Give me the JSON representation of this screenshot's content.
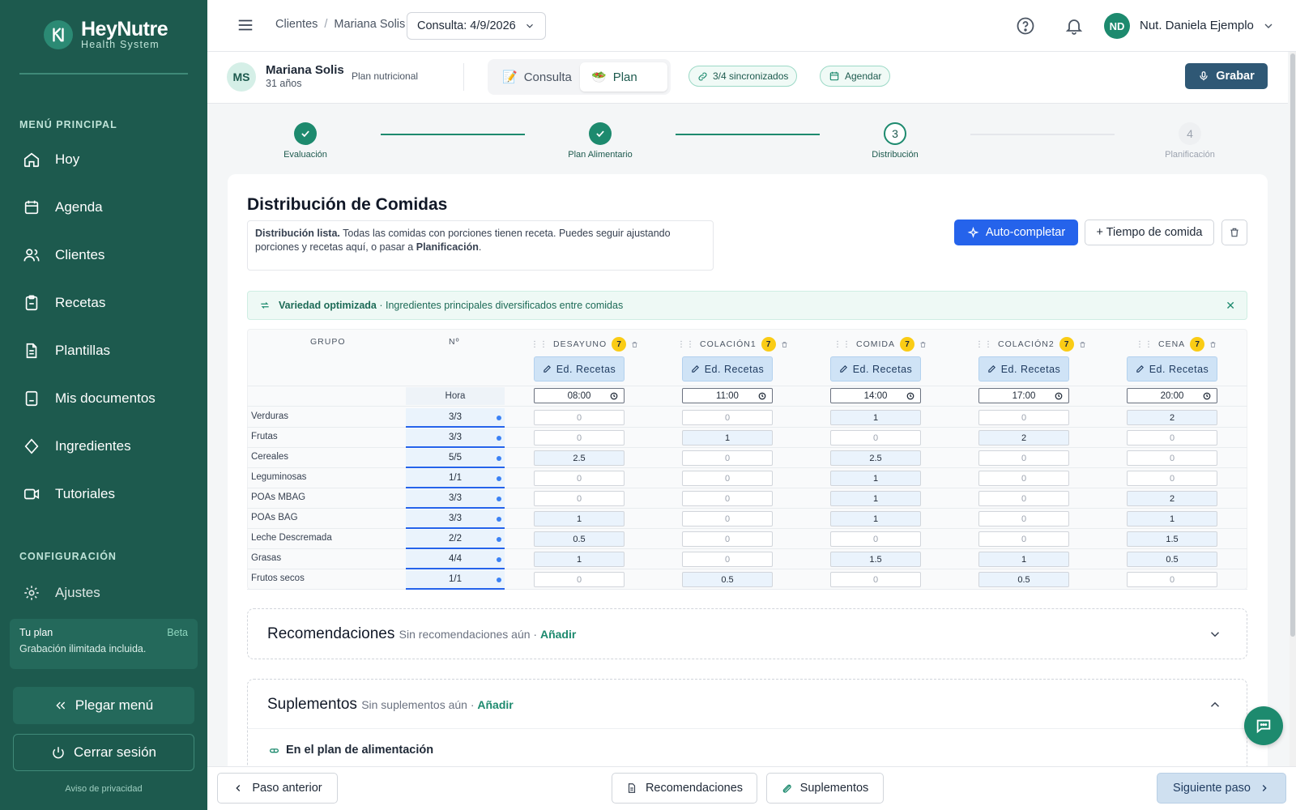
{
  "brand": {
    "name": "HeyNutre",
    "subtitle": "Health System"
  },
  "sidebar": {
    "section_main": "MENÚ PRINCIPAL",
    "items": [
      {
        "label": "Hoy",
        "icon": "home-icon"
      },
      {
        "label": "Agenda",
        "icon": "calendar-icon"
      },
      {
        "label": "Clientes",
        "icon": "users-icon"
      },
      {
        "label": "Recetas",
        "icon": "clipboard-icon"
      },
      {
        "label": "Plantillas",
        "icon": "file-text-icon"
      },
      {
        "label": "Mis documentos",
        "icon": "document-icon"
      },
      {
        "label": "Ingredientes",
        "icon": "tag-icon"
      },
      {
        "label": "Tutoriales",
        "icon": "video-icon"
      }
    ],
    "section_config": "CONFIGURACIÓN",
    "settings_label": "Ajustes",
    "plan": {
      "title": "Tu plan",
      "badge": "Beta",
      "description": "Grabación ilimitada incluida."
    },
    "collapse_label": "Plegar menú",
    "logout_label": "Cerrar sesión",
    "privacy_label": "Aviso de privacidad"
  },
  "topbar": {
    "breadcrumb": [
      "Clientes",
      "Mariana Solis"
    ],
    "breadcrumb_sep": "/",
    "consult_select": "Consulta: 4/9/2026",
    "user_initials": "ND",
    "user_name": "Nut. Daniela Ejemplo"
  },
  "patient": {
    "initials": "MS",
    "name": "Mariana Solis",
    "age": "31 años",
    "plan_label": "Plan nutricional",
    "tabs": [
      {
        "label": "Consulta",
        "active": false
      },
      {
        "label": "Plan",
        "active": true
      }
    ],
    "sync_label": "3/4 sincronizados",
    "schedule_label": "Agendar",
    "record_label": "Grabar"
  },
  "stepper": [
    {
      "number": "1",
      "label": "Evaluación",
      "state": "done"
    },
    {
      "number": "2",
      "label": "Plan Alimentario",
      "state": "done"
    },
    {
      "number": "3",
      "label": "Distribución",
      "state": "current"
    },
    {
      "number": "4",
      "label": "Planificación",
      "state": "todo"
    }
  ],
  "distribution": {
    "title": "Distribución de Comidas",
    "notice_bold": "Distribución lista.",
    "notice_text": " Todas las comidas con porciones tienen receta. Puedes seguir ajustando porciones y recetas aquí, o pasar a ",
    "notice_link": "Planificación",
    "notice_end": ".",
    "auto_label": "Auto-completar",
    "add_time_label": "+ Tiempo de comida",
    "variety_bold": "Variedad optimizada",
    "variety_text": " · Ingredientes principales diversificados entre comidas",
    "col_group": "GRUPO",
    "col_num": "Nº",
    "hour_label": "Hora",
    "edit_recipes_label": "Ed. Recetas",
    "meals": [
      {
        "name": "DESAYUNO",
        "count": "7",
        "time": "08:00"
      },
      {
        "name": "COLACIÓN1",
        "count": "7",
        "time": "11:00"
      },
      {
        "name": "COMIDA",
        "count": "7",
        "time": "14:00"
      },
      {
        "name": "COLACIÓN2",
        "count": "7",
        "time": "17:00"
      },
      {
        "name": "CENA",
        "count": "7",
        "time": "20:00"
      }
    ],
    "rows": [
      {
        "group": "Verduras",
        "total": "3/3",
        "values": [
          "0",
          "0",
          "1",
          "0",
          "2"
        ]
      },
      {
        "group": "Frutas",
        "total": "3/3",
        "values": [
          "0",
          "1",
          "0",
          "2",
          "0"
        ]
      },
      {
        "group": "Cereales",
        "total": "5/5",
        "values": [
          "2.5",
          "0",
          "2.5",
          "0",
          "0"
        ]
      },
      {
        "group": "Leguminosas",
        "total": "1/1",
        "values": [
          "0",
          "0",
          "1",
          "0",
          "0"
        ]
      },
      {
        "group": "POAs MBAG",
        "total": "3/3",
        "values": [
          "0",
          "0",
          "1",
          "0",
          "2"
        ]
      },
      {
        "group": "POAs BAG",
        "total": "3/3",
        "values": [
          "1",
          "0",
          "1",
          "0",
          "1"
        ]
      },
      {
        "group": "Leche Descremada",
        "total": "2/2",
        "values": [
          "0.5",
          "0",
          "0",
          "0",
          "1.5"
        ]
      },
      {
        "group": "Grasas",
        "total": "4/4",
        "values": [
          "1",
          "0",
          "1.5",
          "1",
          "0.5"
        ]
      },
      {
        "group": "Frutos secos",
        "total": "1/1",
        "values": [
          "0",
          "0.5",
          "0",
          "0.5",
          "0"
        ]
      }
    ]
  },
  "recommendations": {
    "title": "Recomendaciones",
    "empty": "Sin recomendaciones aún · ",
    "add": "Añadir"
  },
  "supplements": {
    "title": "Suplementos",
    "empty": "Sin suplementos aún · ",
    "add": "Añadir",
    "subsection": "En el plan de alimentación"
  },
  "bottombar": {
    "prev_label": "Paso anterior",
    "rec_label": "Recomendaciones",
    "supp_label": "Suplementos",
    "next_label": "Siguiente paso"
  },
  "colors": {
    "sidebar": "#1d5a4e",
    "accent": "#1d8a6e",
    "primary_button": "#2563eb",
    "record_button": "#2f5875"
  }
}
